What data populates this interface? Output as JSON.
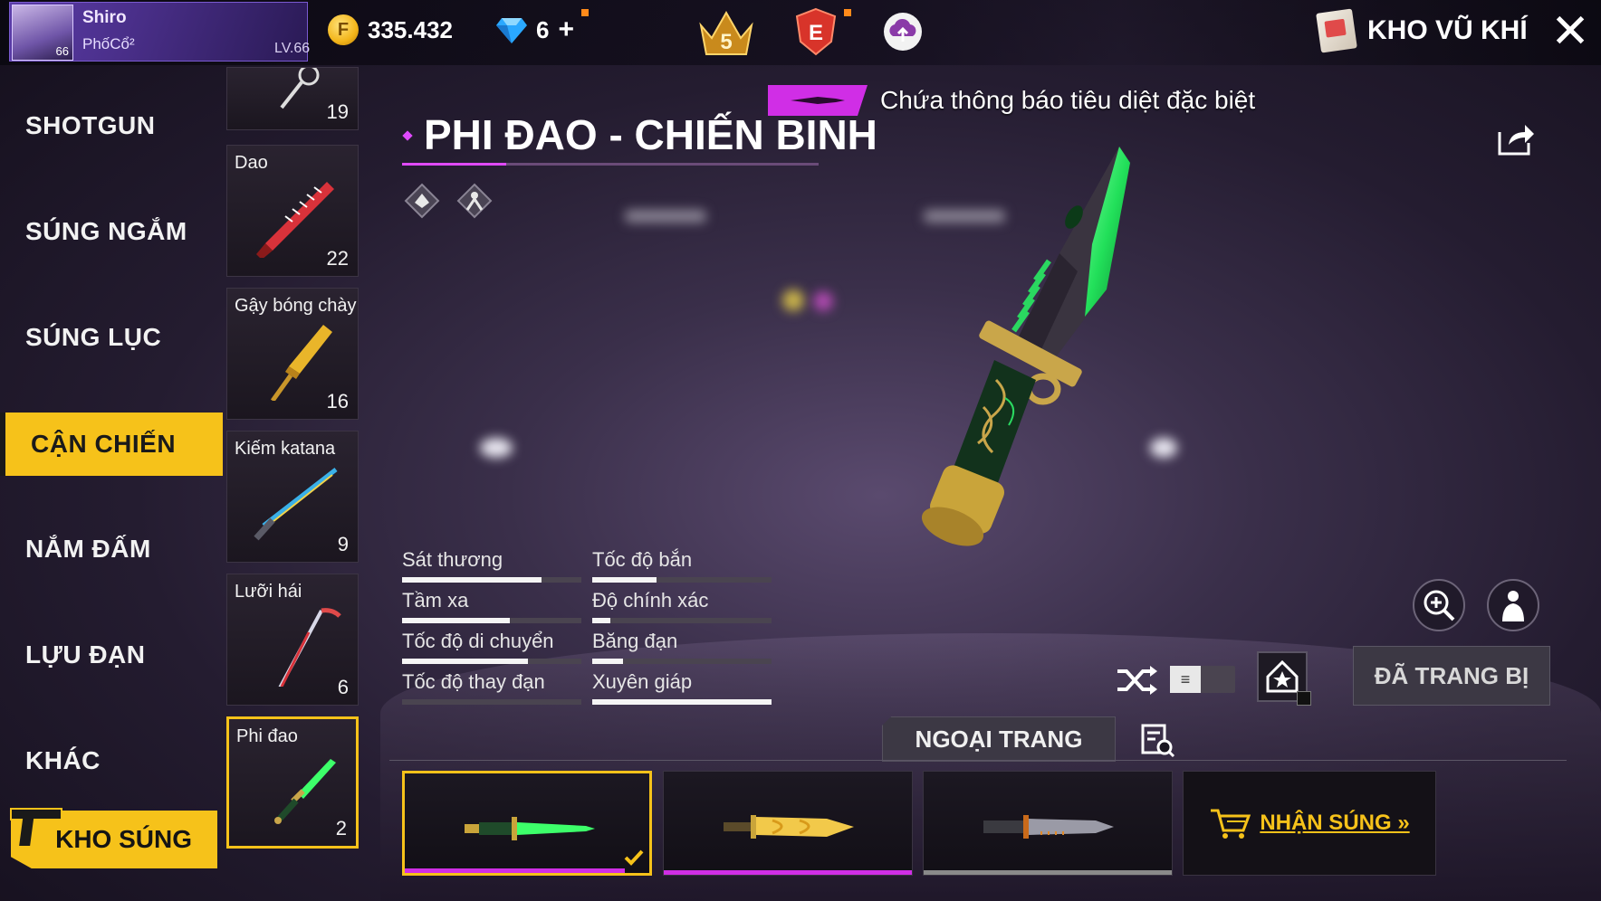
{
  "player": {
    "name": "Shiro",
    "clan": "PhốCổ²",
    "avatar_level": "66",
    "level": "LV.66"
  },
  "currency": {
    "gold": "335.432",
    "diamonds": "6",
    "diamond_plus": "+"
  },
  "badges": {
    "rank_number": "5",
    "elite_letter": "E"
  },
  "header": {
    "title": "KHO VŨ KHÍ",
    "close_symbol": "✕"
  },
  "categories": [
    {
      "label": "SHOTGUN",
      "active": false
    },
    {
      "label": "SÚNG NGẮM",
      "active": false
    },
    {
      "label": "SÚNG LỤC",
      "active": false
    },
    {
      "label": "CẬN CHIẾN",
      "active": true
    },
    {
      "label": "NẮM ĐẤM",
      "active": false
    },
    {
      "label": "LỰU ĐẠN",
      "active": false
    },
    {
      "label": "KHÁC",
      "active": false
    }
  ],
  "armory_button": "KHO SÚNG",
  "weapons": [
    {
      "name": "",
      "count": "19",
      "active": false
    },
    {
      "name": "Dao",
      "count": "22",
      "active": false
    },
    {
      "name": "Gậy bóng chày",
      "count": "16",
      "active": false
    },
    {
      "name": "Kiếm katana",
      "count": "9",
      "active": false
    },
    {
      "name": "Lưỡi hái",
      "count": "6",
      "active": false
    },
    {
      "name": "Phi đao",
      "count": "2",
      "active": true
    }
  ],
  "selected_weapon": {
    "title": "PHI ĐAO - CHIẾN BINH",
    "special_notice": "Chứa thông báo tiêu diệt đặc biệt"
  },
  "stats": [
    {
      "label": "Sát thương",
      "value": 0.78
    },
    {
      "label": "Tốc độ bắn",
      "value": 0.36
    },
    {
      "label": "Tầm xa",
      "value": 0.6
    },
    {
      "label": "Độ chính xác",
      "value": 0.1
    },
    {
      "label": "Tốc độ di chuyển",
      "value": 0.7
    },
    {
      "label": "Băng đạn",
      "value": 0.17
    },
    {
      "label": "Tốc độ thay đạn",
      "value": 0.0
    },
    {
      "label": "Xuyên giáp",
      "value": 1.0
    }
  ],
  "controls": {
    "toggle_symbol": "≡",
    "equipped_label": "ĐÃ TRANG BỊ"
  },
  "skins": {
    "tab_label": "NGOẠI TRANG",
    "get_gun_label": "NHẬN SÚNG »",
    "items": [
      {
        "active": true,
        "rarity_color": "#d02ee6",
        "progress": 0.9
      },
      {
        "active": false,
        "rarity_color": "#d02ee6",
        "progress": 1.0
      },
      {
        "active": false,
        "rarity_color": "#8a8a8a",
        "progress": 1.0
      }
    ]
  },
  "colors": {
    "accent_yellow": "#f6c21a",
    "accent_magenta": "#d02ee6",
    "knife_green": "#3dff6a"
  }
}
